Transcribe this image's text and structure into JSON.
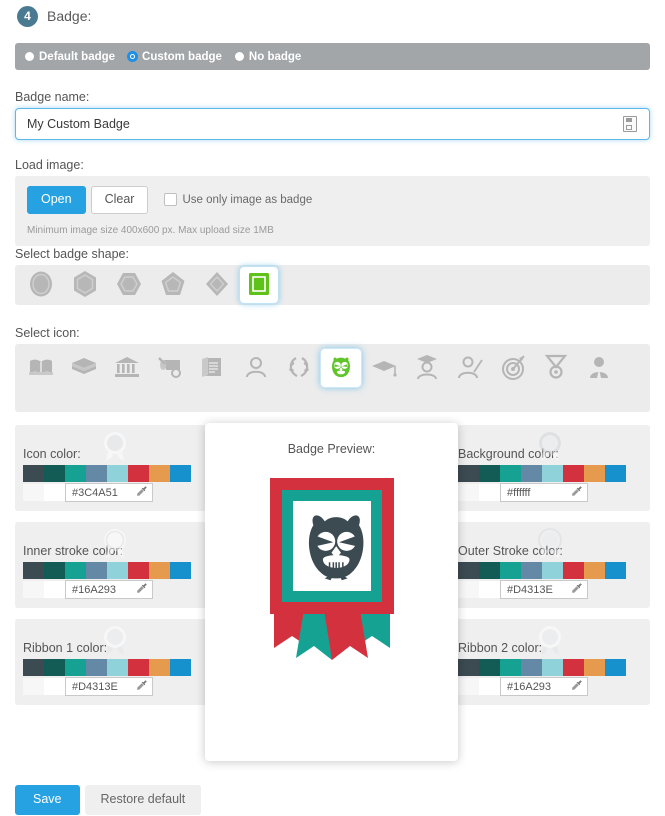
{
  "step": {
    "number": "4",
    "title": "Badge:"
  },
  "badge_type": {
    "options": [
      {
        "label": "Default badge",
        "selected": false
      },
      {
        "label": "Custom badge",
        "selected": true
      },
      {
        "label": "No badge",
        "selected": false
      }
    ]
  },
  "badge_name": {
    "label": "Badge name:",
    "value": "My Custom Badge",
    "placeholder": "Badge name",
    "icon": "save-icon"
  },
  "load_image": {
    "label": "Load image:",
    "open_label": "Open",
    "clear_label": "Clear",
    "checkbox_label": "Use only image as badge",
    "checkbox_checked": false,
    "hint": "Minimum image size 400x600 px. Max upload size 1MB"
  },
  "badge_shape": {
    "label": "Select badge shape:",
    "selected_index": 5,
    "shapes": [
      {
        "name": "circle-shape"
      },
      {
        "name": "hexagon-vertical-shape"
      },
      {
        "name": "hexagon-horizontal-shape"
      },
      {
        "name": "pentagon-shape"
      },
      {
        "name": "diamond-shape"
      },
      {
        "name": "square-shape"
      }
    ],
    "selected_color": "#5bbd0a",
    "idle_color": "#b7b7b7"
  },
  "badge_icon": {
    "label": "Select icon:",
    "selected_index": 7,
    "selected_color": "#5fc52a",
    "idle_color": "#b5b5b5",
    "icons": [
      {
        "name": "open-book-icon"
      },
      {
        "name": "book-stack-icon"
      },
      {
        "name": "bank-columns-icon"
      },
      {
        "name": "diploma-scroll-icon"
      },
      {
        "name": "document-pen-icon"
      },
      {
        "name": "person-icon"
      },
      {
        "name": "laurel-wreath-icon"
      },
      {
        "name": "owl-icon"
      },
      {
        "name": "graduation-cap-icon"
      },
      {
        "name": "graduate-person-icon"
      },
      {
        "name": "teacher-pointer-icon"
      },
      {
        "name": "target-dart-icon"
      },
      {
        "name": "medal-icon"
      },
      {
        "name": "businessman-icon"
      }
    ]
  },
  "palette": [
    "#3C4A51",
    "#135B55",
    "#16A293",
    "#6389A6",
    "#90D2DA",
    "#D4313E",
    "#E69A4D",
    "#1790CE"
  ],
  "color_sections": {
    "icon_color": {
      "label": "Icon color:",
      "value": "#3C4A51"
    },
    "background_color": {
      "label": "Background color:",
      "value": "#ffffff"
    },
    "inner_stroke_color": {
      "label": "Inner stroke color:",
      "value": "#16A293"
    },
    "outer_stroke_color": {
      "label": "Outer Stroke color:",
      "value": "#D4313E"
    },
    "ribbon1_color": {
      "label": "Ribbon 1 color:",
      "value": "#D4313E"
    },
    "ribbon2_color": {
      "label": "Ribbon 2 color:",
      "value": "#16A293"
    }
  },
  "preview": {
    "title": "Badge Preview:",
    "shape": "square",
    "icon": "owl-icon",
    "outer_stroke": "#D4313E",
    "inner_stroke": "#16A293",
    "background": "#ffffff",
    "icon_color": "#3C4A51",
    "ribbon1": "#D4313E",
    "ribbon2": "#16A293"
  },
  "footer": {
    "save_label": "Save",
    "restore_label": "Restore default"
  }
}
